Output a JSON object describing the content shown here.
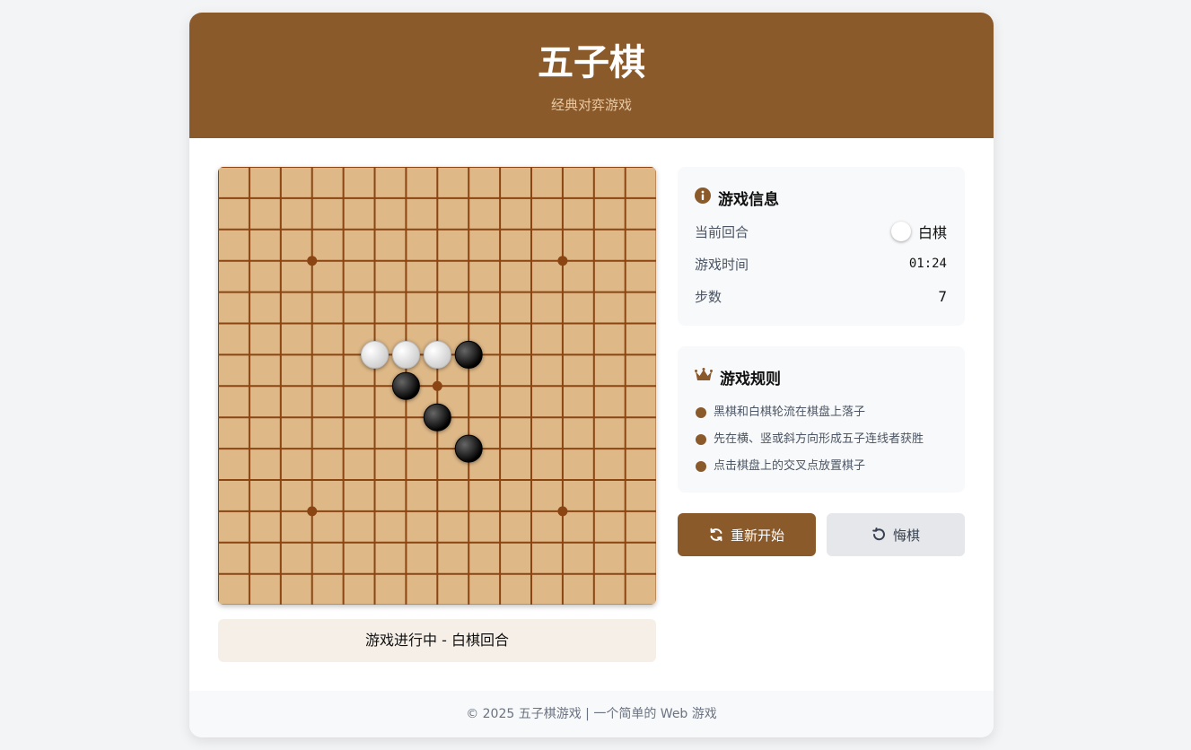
{
  "header": {
    "title": "五子棋",
    "subtitle": "经典对弈游戏"
  },
  "board": {
    "size": 15,
    "star_points": [
      [
        3,
        3
      ],
      [
        3,
        11
      ],
      [
        7,
        7
      ],
      [
        11,
        3
      ],
      [
        11,
        11
      ]
    ],
    "stones": [
      {
        "row": 6,
        "col": 5,
        "color": "white"
      },
      {
        "row": 6,
        "col": 6,
        "color": "white"
      },
      {
        "row": 6,
        "col": 7,
        "color": "white"
      },
      {
        "row": 6,
        "col": 8,
        "color": "black"
      },
      {
        "row": 7,
        "col": 6,
        "color": "black"
      },
      {
        "row": 8,
        "col": 7,
        "color": "black"
      },
      {
        "row": 9,
        "col": 8,
        "color": "black"
      }
    ],
    "colors": {
      "wood": "#deb887",
      "line": "#8b4513"
    }
  },
  "status": {
    "text": "游戏进行中 - 白棋回合"
  },
  "info": {
    "title": "游戏信息",
    "icon": "info-icon",
    "turn_label": "当前回合",
    "turn_value": "白棋",
    "time_label": "游戏时间",
    "time_value": "01:24",
    "steps_label": "步数",
    "steps_value": "7"
  },
  "rules": {
    "title": "游戏规则",
    "icon": "crown-icon",
    "items": [
      "黑棋和白棋轮流在棋盘上落子",
      "先在横、竖或斜方向形成五子连线者获胜",
      "点击棋盘上的交叉点放置棋子"
    ]
  },
  "buttons": {
    "restart_label": "重新开始",
    "restart_icon": "refresh-icon",
    "undo_label": "悔棋",
    "undo_icon": "undo-icon"
  },
  "footer": {
    "text": "© 2025 五子棋游戏 | 一个简单的 Web 游戏"
  },
  "colors": {
    "accent": "#8b5a2b",
    "background": "#f3f4f6"
  }
}
